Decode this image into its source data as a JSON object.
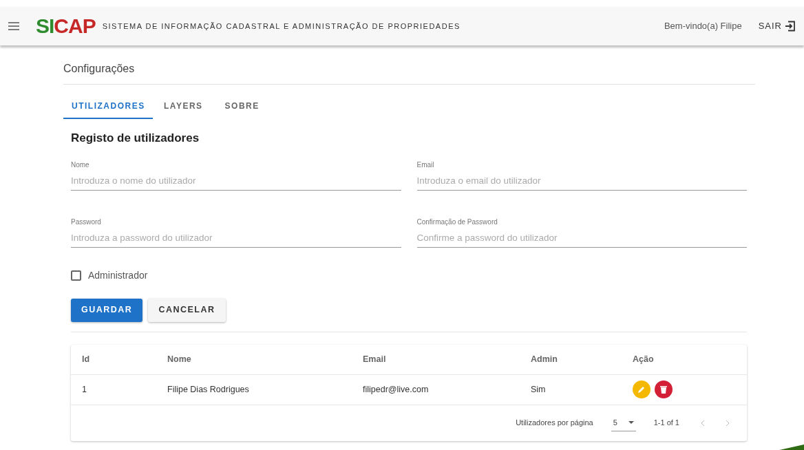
{
  "header": {
    "logo": "SICAP",
    "title": "SISTEMA DE INFORMAÇÃO CADASTRAL E ADMINISTRAÇÃO DE PROPRIEDADES",
    "welcome": "Bem-vindo(a) Filipe",
    "logout": "SAIR"
  },
  "page_title": "Configurações",
  "tabs": [
    {
      "label": "UTILIZADORES",
      "selected": true
    },
    {
      "label": "LAYERS",
      "selected": false
    },
    {
      "label": "SOBRE",
      "selected": false
    }
  ],
  "form": {
    "title": "Registo de utilizadores",
    "fields": [
      {
        "label": "Nome",
        "placeholder": "Introduza o nome do utilizador"
      },
      {
        "label": "Email",
        "placeholder": "Introduza o email do utilizador"
      },
      {
        "label": "Password",
        "placeholder": "Introduza a password do utilizador"
      },
      {
        "label": "Confirmação de Password",
        "placeholder": "Confirme a password do utilizador"
      }
    ],
    "admin_checkbox": {
      "label": "Administrador",
      "checked": false
    },
    "buttons": [
      {
        "label": "GUARDAR",
        "kind": "primary"
      },
      {
        "label": "CANCELAR",
        "kind": "secondary"
      }
    ]
  },
  "table": {
    "columns": [
      "Id",
      "Nome",
      "Email",
      "Admin",
      "Ação"
    ],
    "rows": [
      {
        "cells": [
          "1",
          "Filipe Dias Rodrigues",
          "filipedr@live.com",
          "Sim"
        ]
      }
    ],
    "footer": {
      "rows_per_page_label": "Utilizadores por página",
      "rows_per_page": "5",
      "range": "1-1 of 1"
    }
  }
}
